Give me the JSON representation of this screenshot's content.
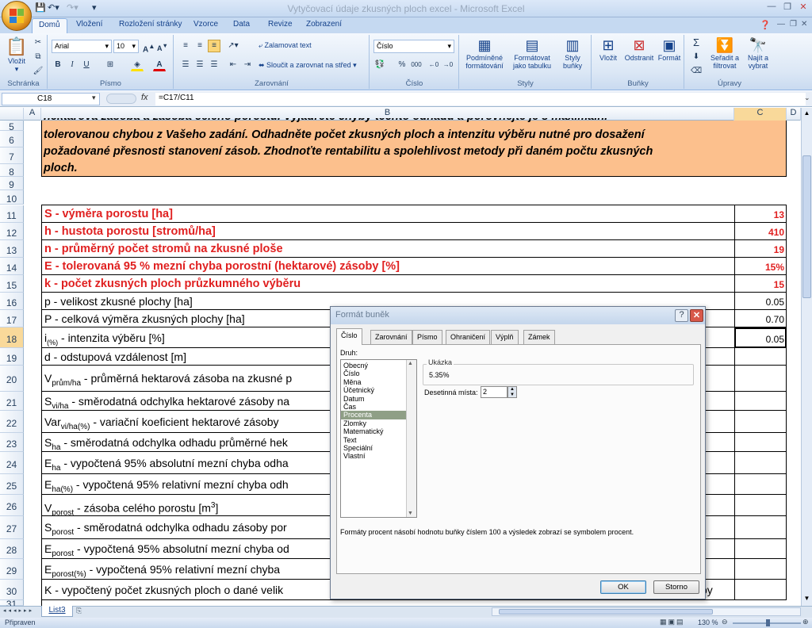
{
  "window": {
    "title": "Vytyčovací údaje zkusných ploch excel - Microsoft Excel"
  },
  "tabs": [
    "Domů",
    "Vložení",
    "Rozložení stránky",
    "Vzorce",
    "Data",
    "Revize",
    "Zobrazení"
  ],
  "ribbon": {
    "groups": {
      "clipboard": "Schránka",
      "font": "Písmo",
      "alignment": "Zarovnání",
      "number": "Číslo",
      "styles": "Styly",
      "cells": "Buňky",
      "editing": "Úpravy"
    },
    "paste": "Vložit",
    "font_name": "Arial",
    "font_size": "10",
    "wrap_text": "Zalamovat text",
    "merge_center": "Sloučit a zarovnat na střed",
    "number_format": "Číslo",
    "cond_format": "Podmíněné formátování",
    "format_table": "Formátovat jako tabulku",
    "cell_styles": "Styly buňky",
    "insert": "Vložit",
    "delete": "Odstranit",
    "format": "Formát",
    "sort_filter": "Seřadit a filtrovat",
    "find_select": "Najít a vybrat"
  },
  "formula_bar": {
    "name_box": "C18",
    "formula": "=C17/C11"
  },
  "columns": [
    "A",
    "B",
    "C",
    "D"
  ],
  "rows": {
    "r5": "hektarová zásoba a zásoba celého porostu. Vyjádřete chyby těchto odhadů a porovnejte je s maximální",
    "r6": "tolerovanou chybou z Vašeho zadání. Odhadněte počet zkusných ploch a intenzitu výběru nutné pro dosažení",
    "r7": "požadované přesnosti stanovení zásob. Zhodnoťte rentabilitu a spolehlivost metody při daném počtu zkusných",
    "r8": "ploch.",
    "r11": {
      "b": "S - výměra porostu [ha]",
      "c": "13"
    },
    "r12": {
      "b": "h - hustota porostu [stromů/ha]",
      "c": "410"
    },
    "r13": {
      "b": "n - průměrný počet stromů na zkusné ploše",
      "c": "19"
    },
    "r14": {
      "b": "E - tolerovaná 95 % mezní chyba porostní (hektarové) zásoby [%]",
      "c": "15%"
    },
    "r15": {
      "b": "k - počet zkusných ploch průzkumného výběru",
      "c": "15"
    },
    "r16": {
      "b": "p - velikost zkusné plochy [ha]",
      "c": "0.05"
    },
    "r17": {
      "b": "P - celková výměra zkusných plochy [ha]",
      "c": "0.70"
    },
    "r18": {
      "b1": "i",
      "sub": "(%)",
      "b2": " - intenzita výběru [%]",
      "c": "0.05"
    },
    "r19": {
      "b": "d - odstupová vzdálenost [m]"
    },
    "r20": {
      "b1": "V",
      "sub": "prům/ha",
      "b2": " - průměrná hektarová zásoba na zkusné p"
    },
    "r21": {
      "b1": "S",
      "sub": "vi/ha",
      "b2": " - směrodatná odchylka hektarové zásoby na"
    },
    "r22": {
      "b1": "Var",
      "sub": "vi/ha(%)",
      "b2": " - variační koeficient hektarové zásoby"
    },
    "r23": {
      "b1": "S",
      "sub": "ha",
      "b2": " - směrodatná odchylka odhadu průměrné hek"
    },
    "r24": {
      "b1": "E",
      "sub": "ha",
      "b2": " - vypočtená 95% absolutní mezní chyba odha"
    },
    "r25": {
      "b1": "E",
      "sub": "ha(%)",
      "b2": " - vypočtená 95% relativní mezní chyba odh"
    },
    "r26": {
      "b1": "V",
      "sub": "porost",
      "b2": " - zásoba celého porostu [m",
      "sup": "3",
      "b3": "]"
    },
    "r27": {
      "b1": "S",
      "sub": "porost",
      "b2": " - směrodatná odchylka odhadu zásoby por"
    },
    "r28": {
      "b1": "E",
      "sub": "porost",
      "b2": " - vypočtená 95% absolutní mezní chyba od"
    },
    "r29": {
      "b1": "E",
      "sub": "porost(%)",
      "b2": " - vypočtená 95% relativní mezní chyba"
    },
    "r30": {
      "b": "K - vypočtený počet zkusných ploch o dané velik",
      "tail": "by"
    }
  },
  "dialog": {
    "title": "Formát buněk",
    "tabs": [
      "Číslo",
      "Zarovnání",
      "Písmo",
      "Ohraničení",
      "Výplň",
      "Zámek"
    ],
    "category_label": "Druh:",
    "categories": [
      "Obecný",
      "Číslo",
      "Měna",
      "Účetnický",
      "Datum",
      "Čas",
      "Procenta",
      "Zlomky",
      "Matematický",
      "Text",
      "Speciální",
      "Vlastní"
    ],
    "selected_category": "Procenta",
    "sample_label": "Ukázka",
    "sample_value": "5.35%",
    "decimals_label": "Desetinná místa:",
    "decimals_value": "2",
    "description": "Formáty procent násobí hodnotu buňky číslem 100 a výsledek zobrazí se symbolem procent.",
    "ok": "OK",
    "cancel": "Storno"
  },
  "sheet_tab": "List3",
  "status": {
    "ready": "Připraven",
    "zoom": "130 %"
  }
}
